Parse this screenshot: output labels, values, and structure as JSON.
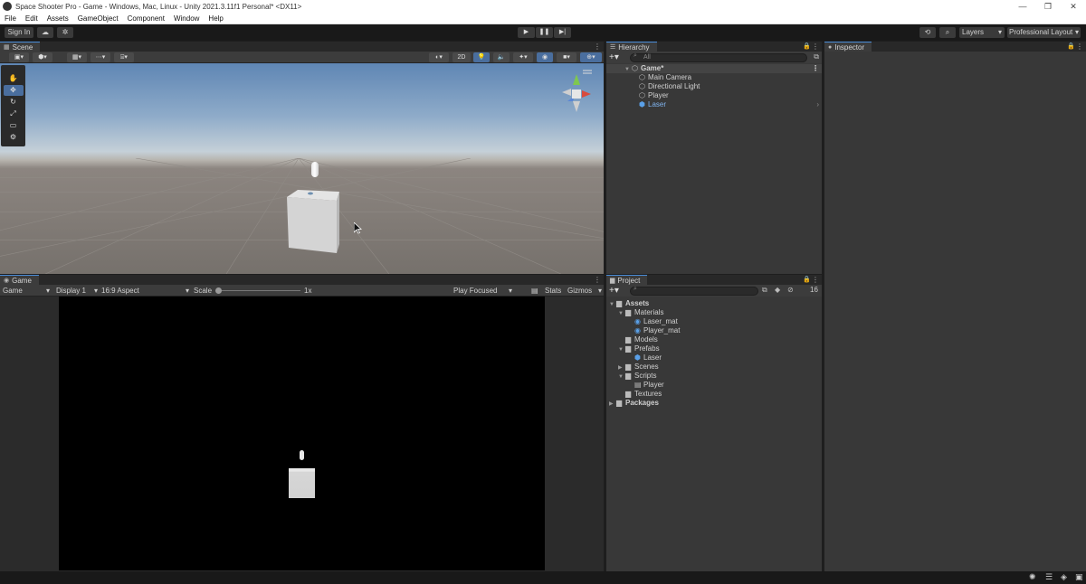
{
  "window": {
    "title": "Space Shooter Pro - Game - Windows, Mac, Linux - Unity 2021.3.11f1 Personal* <DX11>",
    "minimize": "—",
    "maximize": "❐",
    "close": "✕"
  },
  "menu": [
    "File",
    "Edit",
    "Assets",
    "GameObject",
    "Component",
    "Window",
    "Help"
  ],
  "toolbar": {
    "sign_in": "Sign In",
    "cloud_icon": "☁",
    "collab_icon": "✲",
    "play": "▶",
    "pause": "❚❚",
    "step": "▶|",
    "history_icon": "⟲",
    "search_icon": "⌕",
    "layers": "Layers",
    "layout": "Professional Layout"
  },
  "scene": {
    "tab": "Scene",
    "mode_2d": "2D",
    "tools": [
      "✋",
      "✥",
      "↻",
      "⤢",
      "▭",
      "⚙"
    ]
  },
  "game": {
    "tab": "Game",
    "view_select": "Game",
    "display": "Display 1",
    "aspect": "16:9 Aspect",
    "scale_label": "Scale",
    "scale_value": "1x",
    "play_focused": "Play Focused",
    "stats": "Stats",
    "gizmos": "Gizmos"
  },
  "hierarchy": {
    "tab": "Hierarchy",
    "search_placeholder": "All",
    "scene_name": "Game*",
    "items": [
      "Main Camera",
      "Directional Light",
      "Player",
      "Laser"
    ],
    "selected": "Laser"
  },
  "inspector": {
    "tab": "Inspector"
  },
  "project": {
    "tab": "Project",
    "badge_count": "16",
    "tree": [
      {
        "label": "Assets",
        "depth": 0,
        "expanded": true,
        "icon": "folder",
        "bold": true
      },
      {
        "label": "Materials",
        "depth": 1,
        "expanded": true,
        "icon": "folder"
      },
      {
        "label": "Laser_mat",
        "depth": 2,
        "icon": "material"
      },
      {
        "label": "Player_mat",
        "depth": 2,
        "icon": "material"
      },
      {
        "label": "Models",
        "depth": 1,
        "icon": "folder"
      },
      {
        "label": "Prefabs",
        "depth": 1,
        "expanded": true,
        "icon": "folder"
      },
      {
        "label": "Laser",
        "depth": 2,
        "icon": "prefab"
      },
      {
        "label": "Scenes",
        "depth": 1,
        "collapsed": true,
        "icon": "folder"
      },
      {
        "label": "Scripts",
        "depth": 1,
        "expanded": true,
        "icon": "folder"
      },
      {
        "label": "Player",
        "depth": 2,
        "icon": "script"
      },
      {
        "label": "Textures",
        "depth": 1,
        "icon": "folder"
      },
      {
        "label": "Packages",
        "depth": 0,
        "collapsed": true,
        "icon": "folder",
        "bold": true
      }
    ]
  }
}
